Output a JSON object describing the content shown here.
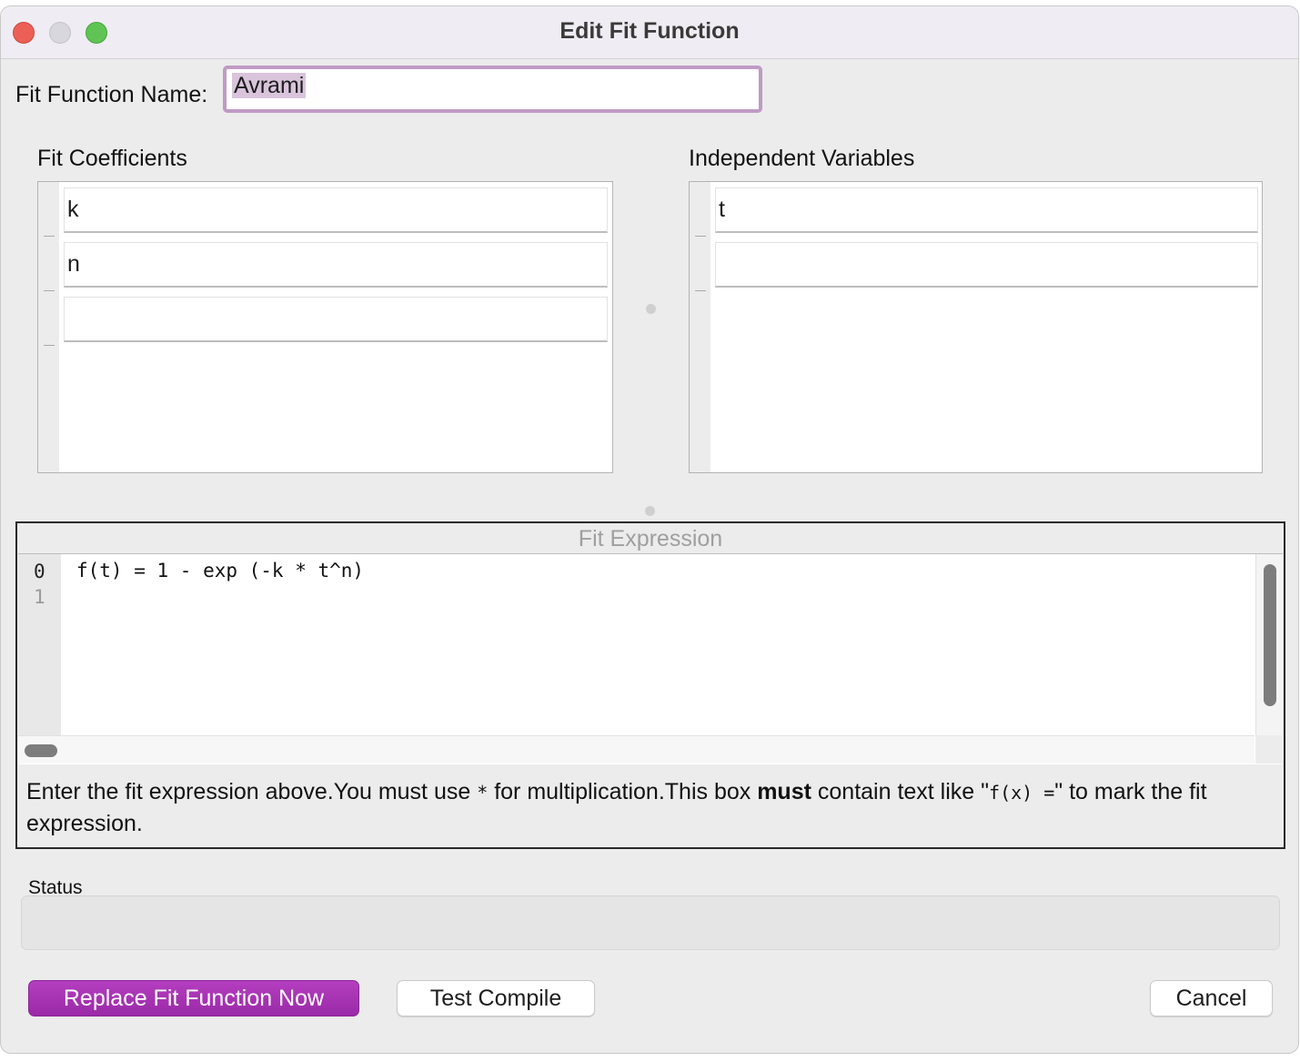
{
  "window": {
    "title": "Edit Fit Function"
  },
  "name_field": {
    "label": "Fit Function Name:",
    "value": "Avrami"
  },
  "coefficients": {
    "header": "Fit Coefficients",
    "items": [
      "k",
      "n",
      ""
    ]
  },
  "variables": {
    "header": "Independent Variables",
    "items": [
      "t",
      ""
    ]
  },
  "expression": {
    "title": "Fit Expression",
    "line_numbers": [
      "0",
      "1"
    ],
    "lines": [
      "f(t) = 1 - exp (-k * t^n)"
    ],
    "help": {
      "part1": "Enter the fit expression above.You must use ",
      "mult": "*",
      "part2": " for multiplication.This box ",
      "bold": "must",
      "part3": " contain text like \"",
      "example": "f(x) =",
      "part4": "\" to mark the fit expression."
    }
  },
  "status": {
    "label": "Status",
    "value": ""
  },
  "buttons": {
    "replace": "Replace Fit Function Now",
    "test_compile": "Test Compile",
    "cancel": "Cancel"
  }
}
